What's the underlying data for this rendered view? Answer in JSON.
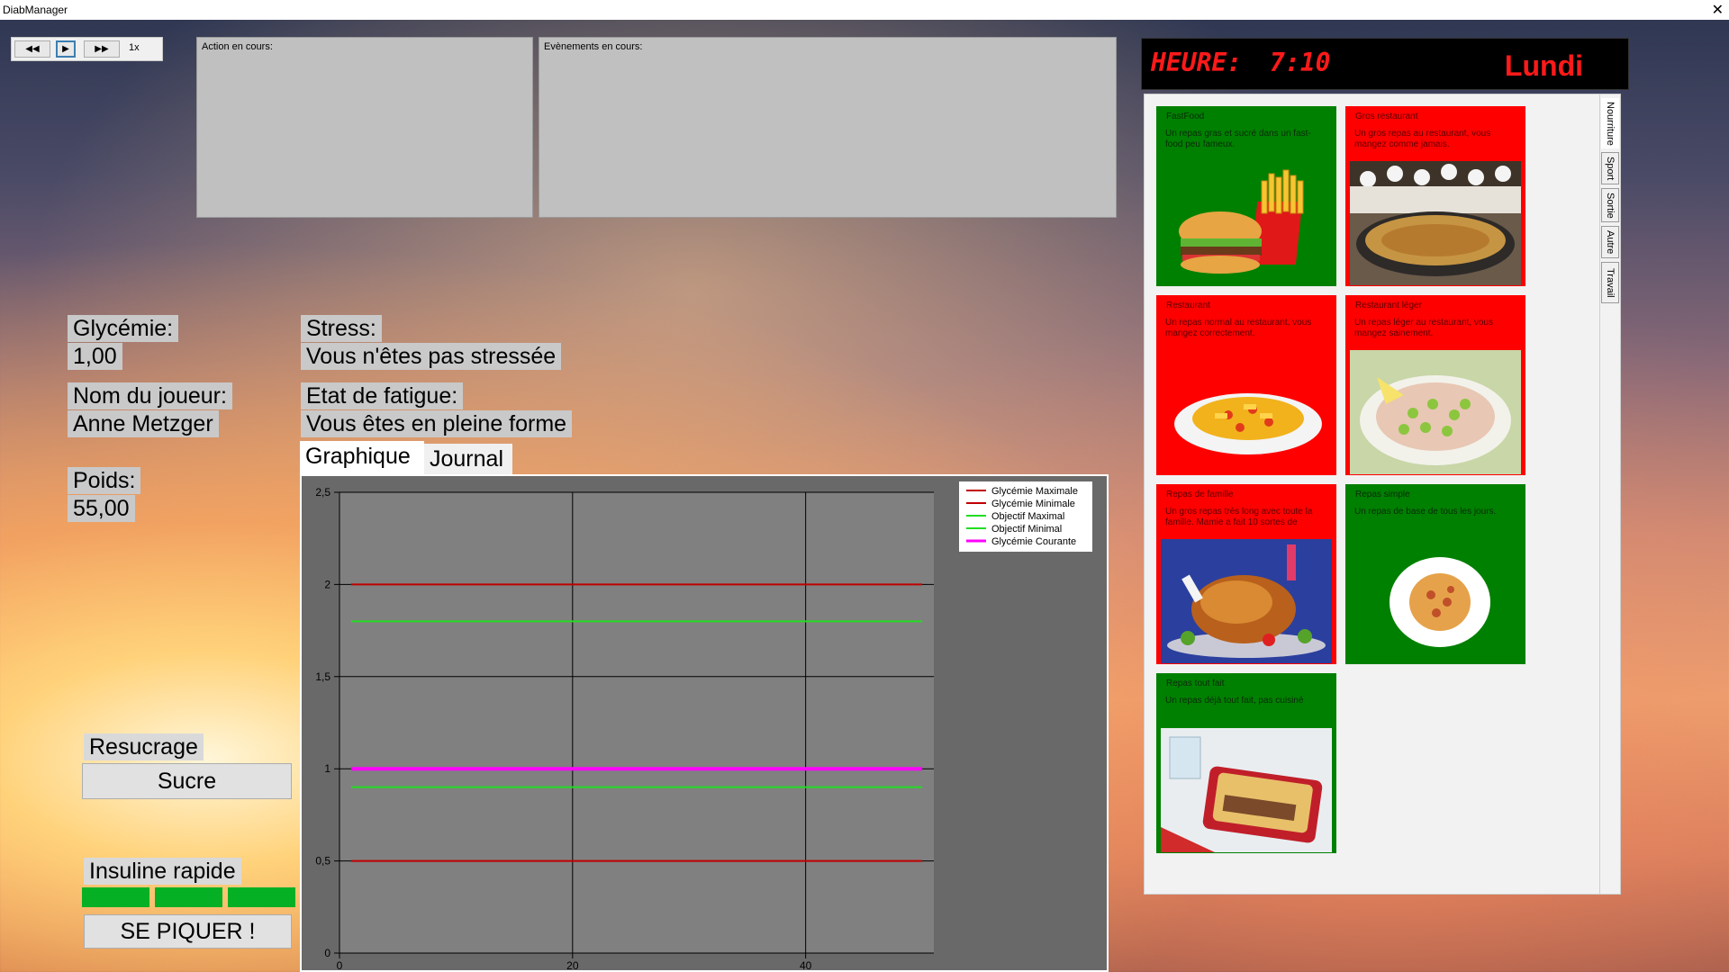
{
  "window": {
    "title": "DiabManager",
    "close": "✕"
  },
  "controls": {
    "rewind": "◀◀",
    "play": "▶",
    "forward": "▶▶",
    "speed": "1x"
  },
  "panels": {
    "action_label": "Action en cours:",
    "events_label": "Evènements en cours:"
  },
  "clock": {
    "label": "HEURE:",
    "time": "7:10",
    "day": "Lundi",
    "color": "#ff1a1a"
  },
  "tabs_vertical": [
    "Nourriture",
    "Sport",
    "Sortie",
    "Autre",
    "Travail"
  ],
  "food": [
    {
      "title": "FastFood",
      "desc": "Un repas gras et sucré dans un fast-food peu fameux.",
      "color": "green",
      "icon": "burger-fries-image"
    },
    {
      "title": "Gros restaurant",
      "desc": "Un gros repas au restaurant, vous mangez comme jamais.",
      "color": "red",
      "icon": "chefs-paella-image"
    },
    {
      "title": "Restaurant",
      "desc": "Un repas normal au restaurant, vous mangez correctement.",
      "color": "red",
      "icon": "pasta-plate-image"
    },
    {
      "title": "Restaurant léger",
      "desc": "Un repas léger au restaurant, vous mangez sainement.",
      "color": "red",
      "icon": "salad-image"
    },
    {
      "title": "Repas de famille",
      "desc": "Un gros repas très long avec toute la famille. Mamie a fait 10 sortes de",
      "color": "red",
      "icon": "roast-turkey-image"
    },
    {
      "title": "Repas simple",
      "desc": "Un repas de base de tous les jours.",
      "color": "green",
      "icon": "pasta-bowl-image"
    },
    {
      "title": "Repas tout fait",
      "desc": "Un repas déjà tout fait, pas cuisiné",
      "color": "green",
      "icon": "gratin-dish-image"
    }
  ],
  "player": {
    "glycemie_label": "Glycémie:",
    "glycemie_value": "1,00",
    "name_label": "Nom du joueur:",
    "name_value": "Anne Metzger",
    "poids_label": "Poids:",
    "poids_value": "55,00",
    "stress_label": "Stress:",
    "stress_value": "Vous n'êtes pas stressée",
    "fatigue_label": "Etat de fatigue:",
    "fatigue_value": "Vous êtes en pleine forme"
  },
  "view_tabs": {
    "graph": "Graphique",
    "journal": "Journal"
  },
  "actions": {
    "resucrage_label": "Resucrage",
    "sucre_button": "Sucre",
    "insuline_label": "Insuline rapide",
    "inject_button": "SE PIQUER !",
    "insuline_level": 1.0
  },
  "chart_data": {
    "type": "line",
    "x_ticks": [
      "0",
      "20",
      "40"
    ],
    "y_ticks": [
      "0",
      "0,5",
      "1",
      "1,5",
      "2",
      "2,5"
    ],
    "xlim": [
      0,
      51
    ],
    "ylim": [
      0,
      2.5
    ],
    "grid": true,
    "legend_position": "top-right",
    "series": [
      {
        "name": "Glycémie Maximale",
        "color": "#c00000",
        "x": [
          1,
          50
        ],
        "values": [
          2,
          2
        ]
      },
      {
        "name": "Glycémie Minimale",
        "color": "#c00000",
        "x": [
          1,
          50
        ],
        "values": [
          0.5,
          0.5
        ]
      },
      {
        "name": "Objectif Maximal",
        "color": "#22dd22",
        "x": [
          1,
          50
        ],
        "values": [
          1.8,
          1.8
        ]
      },
      {
        "name": "Objectif Minimal",
        "color": "#22dd22",
        "x": [
          1,
          50
        ],
        "values": [
          0.9,
          0.9
        ]
      },
      {
        "name": "Glycémie Courante",
        "color": "#ff00ff",
        "x": [
          1,
          50
        ],
        "values": [
          1,
          1
        ]
      }
    ]
  }
}
